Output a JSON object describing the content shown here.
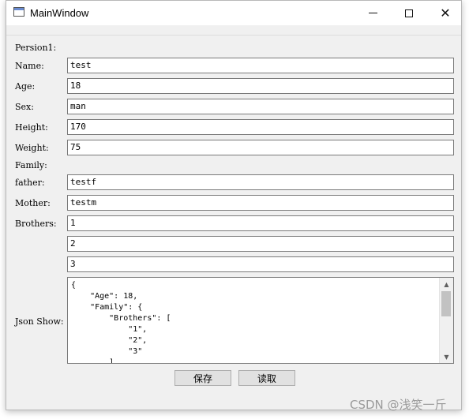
{
  "window": {
    "title": "MainWindow"
  },
  "form": {
    "section_label": "Persion1:",
    "fields": [
      {
        "label": "Name:",
        "value": "test"
      },
      {
        "label": "Age:",
        "value": "18"
      },
      {
        "label": "Sex:",
        "value": "man"
      },
      {
        "label": "Height:",
        "value": "170"
      },
      {
        "label": "Weight:",
        "value": "75"
      }
    ],
    "family_label": "Family:",
    "family_fields": [
      {
        "label": "father:",
        "value": "testf"
      },
      {
        "label": "Mother:",
        "value": "testm"
      }
    ],
    "brothers_label": "Brothers:",
    "brothers": [
      "1",
      "2",
      "3"
    ],
    "json_label": "Json Show:",
    "json_lines": [
      "{",
      "    \"Age\": 18,",
      "    \"Family\": {",
      "        \"Brothers\": [",
      "            \"1\",",
      "            \"2\",",
      "            \"3\"",
      "        ]"
    ]
  },
  "buttons": {
    "save": "保存",
    "read": "读取"
  },
  "watermark": "CSDN @浅笑一斤"
}
